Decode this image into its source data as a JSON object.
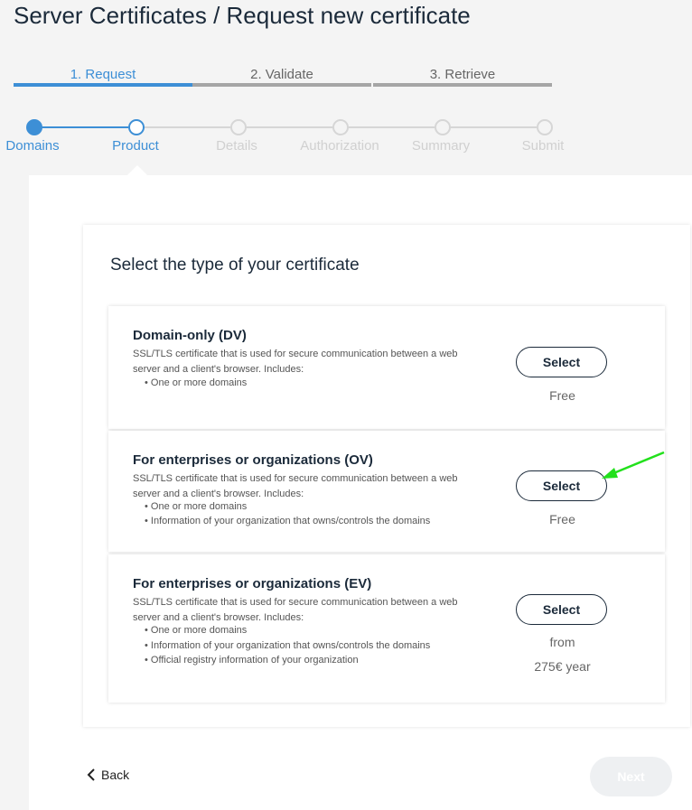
{
  "page": {
    "title": "Server Certificates / Request new certificate"
  },
  "tabs": [
    {
      "label": "1. Request",
      "active": true
    },
    {
      "label": "2. Validate",
      "active": false
    },
    {
      "label": "3. Retrieve",
      "active": false
    }
  ],
  "steps": [
    {
      "label": "Domains",
      "state": "done"
    },
    {
      "label": "Product",
      "state": "current"
    },
    {
      "label": "Details",
      "state": "pending"
    },
    {
      "label": "Authorization",
      "state": "pending"
    },
    {
      "label": "Summary",
      "state": "pending"
    },
    {
      "label": "Submit",
      "state": "pending"
    }
  ],
  "card": {
    "title": "Select the type of your certificate",
    "options": [
      {
        "name": "Domain-only (DV)",
        "description": "SSL/TLS certificate that is used for secure communication between a web server and a client's browser. Includes:",
        "features": [
          "• One or more domains"
        ],
        "button": "Select",
        "price_lines": [
          "Free"
        ]
      },
      {
        "name": "For enterprises or organizations (OV)",
        "description": "SSL/TLS certificate that is used for secure communication between a web server and a client's browser. Includes:",
        "features": [
          "• One or more domains",
          "• Information of your organization that owns/controls the domains"
        ],
        "button": "Select",
        "price_lines": [
          "Free"
        ]
      },
      {
        "name": "For enterprises or organizations (EV)",
        "description": "SSL/TLS certificate that is used for secure communication between a web server and a client's browser. Includes:",
        "features": [
          "• One or more domains",
          "• Information of your organization that owns/controls the domains",
          "• Official registry information of your organization"
        ],
        "button": "Select",
        "price_lines": [
          "from",
          "275€ year"
        ]
      }
    ]
  },
  "footer": {
    "back_label": "Back",
    "next_label": "Next"
  },
  "colors": {
    "accent": "#3d8fd6",
    "annotation_arrow": "#22e01c"
  }
}
